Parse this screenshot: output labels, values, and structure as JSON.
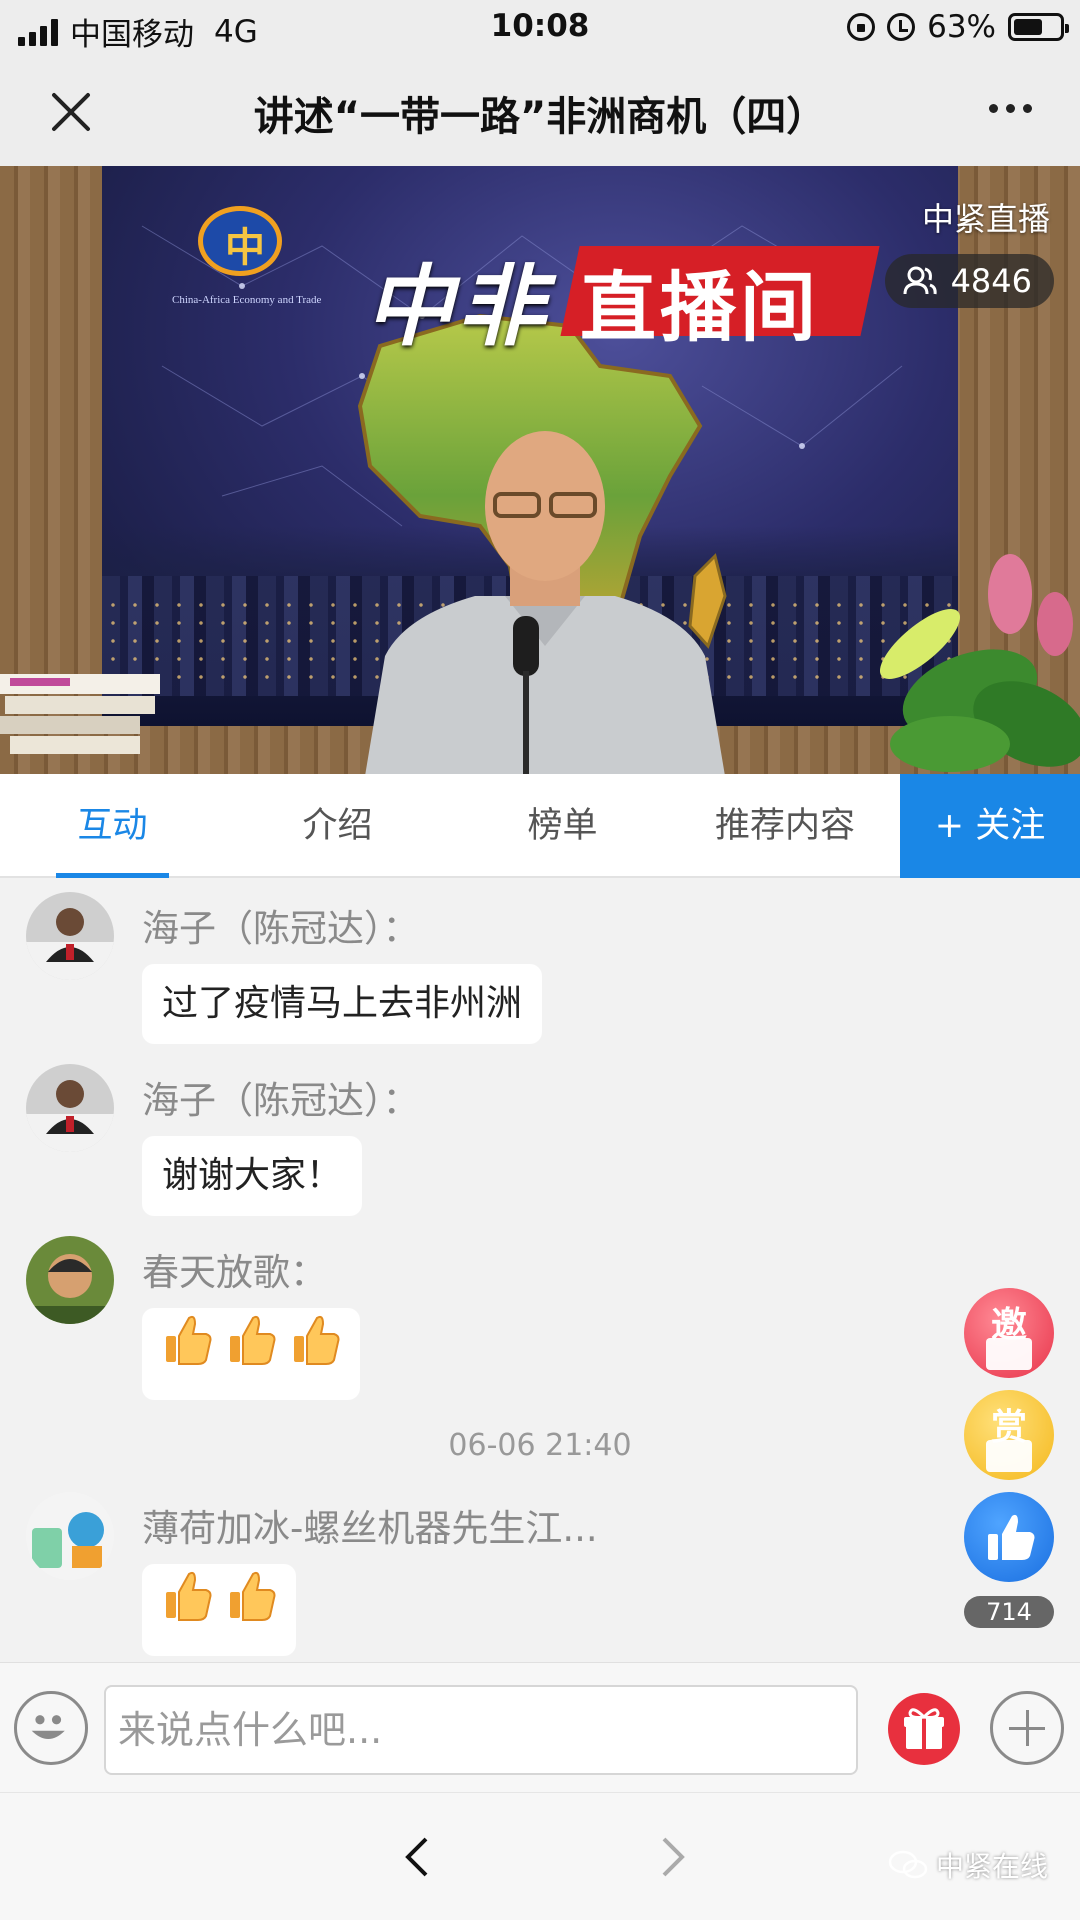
{
  "status_bar": {
    "carrier": "中国移动",
    "network": "4G",
    "time": "10:08",
    "battery_percent": "63%",
    "battery_level": 0.63
  },
  "header": {
    "title": "讲述“一带一路”非洲商机（四）",
    "close_icon": "close-icon",
    "more_icon": "more-icon"
  },
  "video": {
    "live_label": "中紧直播",
    "viewer_count": "4846",
    "banner_white": "中非",
    "banner_red": "直播间",
    "logo_caption": "China-Africa Economy and Trade"
  },
  "tabs": [
    {
      "label": "互动",
      "active": true
    },
    {
      "label": "介绍",
      "active": false
    },
    {
      "label": "榜单",
      "active": false
    },
    {
      "label": "推荐内容",
      "active": false
    }
  ],
  "follow_label": "+ 关注",
  "messages": [
    {
      "user": "海子（陈冠达）：",
      "text": "过了疫情马上去非州洲"
    },
    {
      "user": "海子（陈冠达）：",
      "text": "谢谢大家！"
    },
    {
      "user": "春天放歌：",
      "thumbs": 3
    },
    {
      "user": "薄荷加冰-螺丝机器先生江...",
      "thumbs": 2
    }
  ],
  "timestamp": "06-06 21:40",
  "floating": {
    "invite_label": "邀",
    "reward_label": "赏",
    "like_count": "714"
  },
  "input": {
    "placeholder": "来说点什么吧..."
  },
  "watermark": "中紧在线",
  "colors": {
    "accent": "#1a87e6",
    "invite": "#e8344a",
    "reward": "#f4b81c",
    "gift": "#e8303e"
  }
}
